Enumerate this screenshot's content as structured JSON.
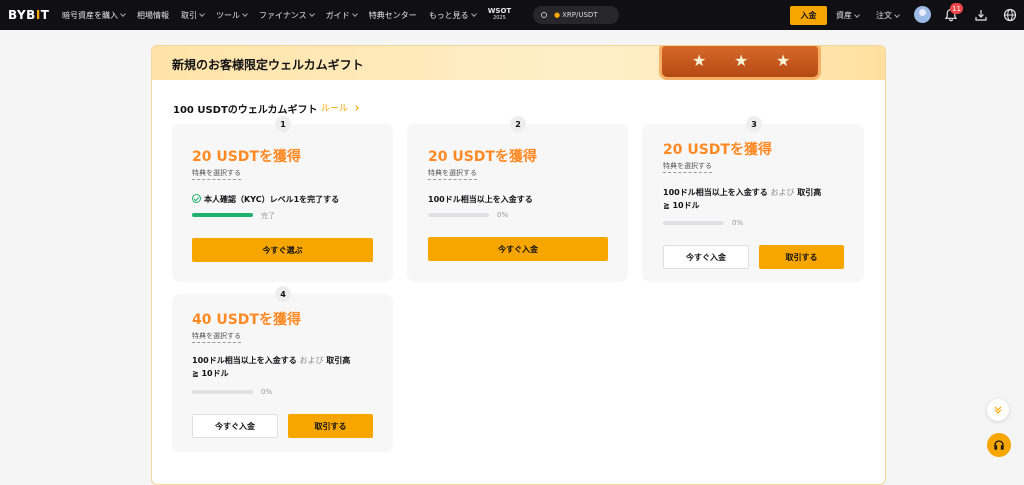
{
  "topbar": {
    "logo_left": "BYB",
    "logo_bar": "I",
    "logo_right": "T",
    "nav": [
      {
        "label": "暗号資産を購入",
        "chevron": true
      },
      {
        "label": "相場情報",
        "chevron": false
      },
      {
        "label": "取引",
        "chevron": true
      },
      {
        "label": "ツール",
        "chevron": true
      },
      {
        "label": "ファイナンス",
        "chevron": true
      },
      {
        "label": "ガイド",
        "chevron": true
      },
      {
        "label": "特典センター",
        "chevron": false
      },
      {
        "label": "もっと見る",
        "chevron": true
      }
    ],
    "wsot_title": "WSOT",
    "wsot_year": "2025",
    "search_value": "XRP/USDT",
    "deposit_label": "入金",
    "assets_label": "資産",
    "orders_label": "注文",
    "notification_count": "11"
  },
  "card": {
    "title": "新規のお客様限定ウェルカムギフト",
    "section_title": "100 USDTのウェルカムギフト",
    "rule_label": "ルール"
  },
  "tasks": [
    {
      "step": "1",
      "reward": "20 USDTを獲得",
      "select": "特典を選択する",
      "desc": "本人確認（KYC）レベル1を完了する",
      "progress": 1.0,
      "progress_label": "完了",
      "primary_button": "今すぐ選ぶ"
    },
    {
      "step": "2",
      "reward": "20 USDTを獲得",
      "select": "特典を選択する",
      "desc": "100ドル相当以上を入金する",
      "progress": 0,
      "progress_label": "0%",
      "primary_button": "今すぐ入金"
    },
    {
      "step": "3",
      "reward": "20 USDTを獲得",
      "select": "特典を選択する",
      "desc_a": "100ドル相当以上を入金する",
      "desc_and": "および",
      "desc_b": "取引高",
      "desc_c": "≧ 10ドル",
      "progress": 0,
      "progress_label": "0%",
      "secondary_button": "今すぐ入金",
      "primary_button": "取引する"
    },
    {
      "step": "4",
      "reward": "40 USDTを獲得",
      "select": "特典を選択する",
      "desc_a": "100ドル相当以上を入金する",
      "desc_and": "および",
      "desc_b": "取引高",
      "desc_c": "≧ 10ドル",
      "progress": 0,
      "progress_label": "0%",
      "secondary_button": "今すぐ入金",
      "primary_button": "取引する"
    }
  ],
  "colors": {
    "accent": "#f7a600",
    "reward": "#ff8a24",
    "success": "#20b26c",
    "topbar": "#101014"
  }
}
